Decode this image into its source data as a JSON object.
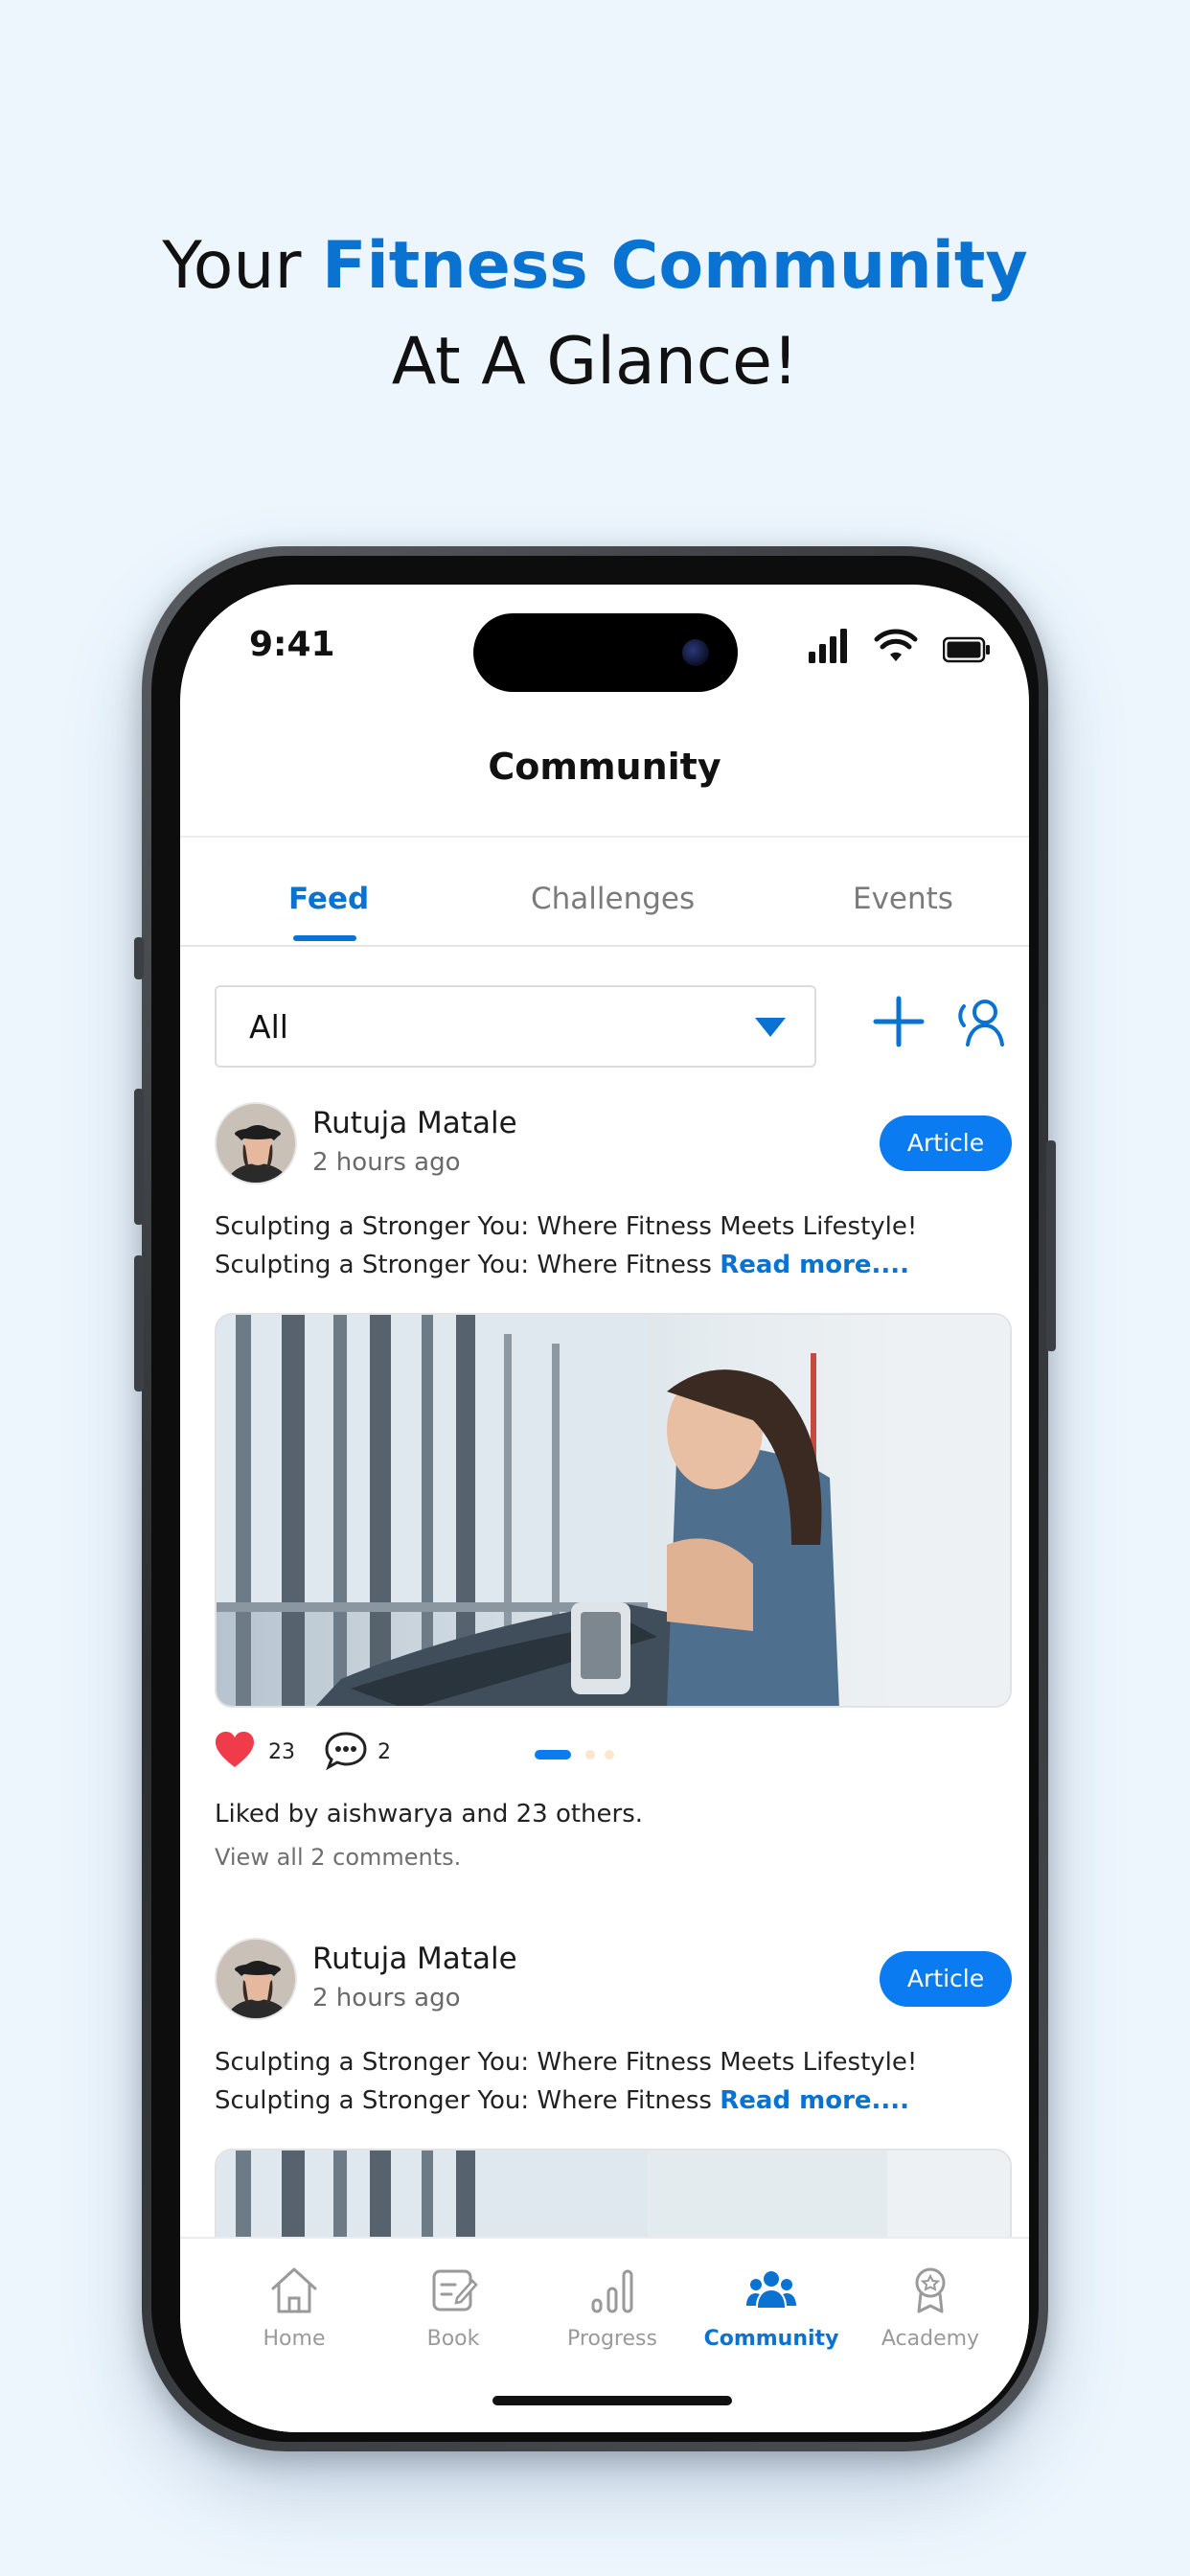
{
  "headline": {
    "prefix": "Your ",
    "accent": "Fitness Community",
    "suffix": " At A Glance!"
  },
  "status_bar": {
    "time": "9:41"
  },
  "app": {
    "title": "Community"
  },
  "tabs": [
    {
      "label": "Feed",
      "active": true
    },
    {
      "label": "Challenges",
      "active": false
    },
    {
      "label": "Events",
      "active": false
    }
  ],
  "filter": {
    "selected": "All"
  },
  "posts": [
    {
      "author": "Rutuja Matale",
      "time_ago": "2 hours ago",
      "badge": "Article",
      "text_line1": "Sculpting a Stronger You: Where Fitness Meets Lifestyle!",
      "text_line2": "Sculpting a Stronger You: Where Fitness",
      "read_more": "Read more....",
      "likes": "23",
      "comments": "2",
      "liked_by": "Liked by aishwarya and 23 others.",
      "view_comments": "View all 2 comments."
    },
    {
      "author": "Rutuja Matale",
      "time_ago": "2 hours ago",
      "badge": "Article",
      "text_line1": "Sculpting a Stronger You: Where Fitness Meets Lifestyle!",
      "text_line2": "Sculpting a Stronger You: Where Fitness",
      "read_more": "Read more...."
    }
  ],
  "bottom_nav": [
    {
      "label": "Home",
      "icon": "home-icon",
      "active": false
    },
    {
      "label": "Book",
      "icon": "book-icon",
      "active": false
    },
    {
      "label": "Progress",
      "icon": "progress-icon",
      "active": false
    },
    {
      "label": "Community",
      "icon": "community-icon",
      "active": true
    },
    {
      "label": "Academy",
      "icon": "academy-icon",
      "active": false
    }
  ],
  "colors": {
    "accent": "#0a72d1",
    "badge": "#0a7bf0",
    "like": "#ef3b4a",
    "background": "#edf6fd"
  }
}
